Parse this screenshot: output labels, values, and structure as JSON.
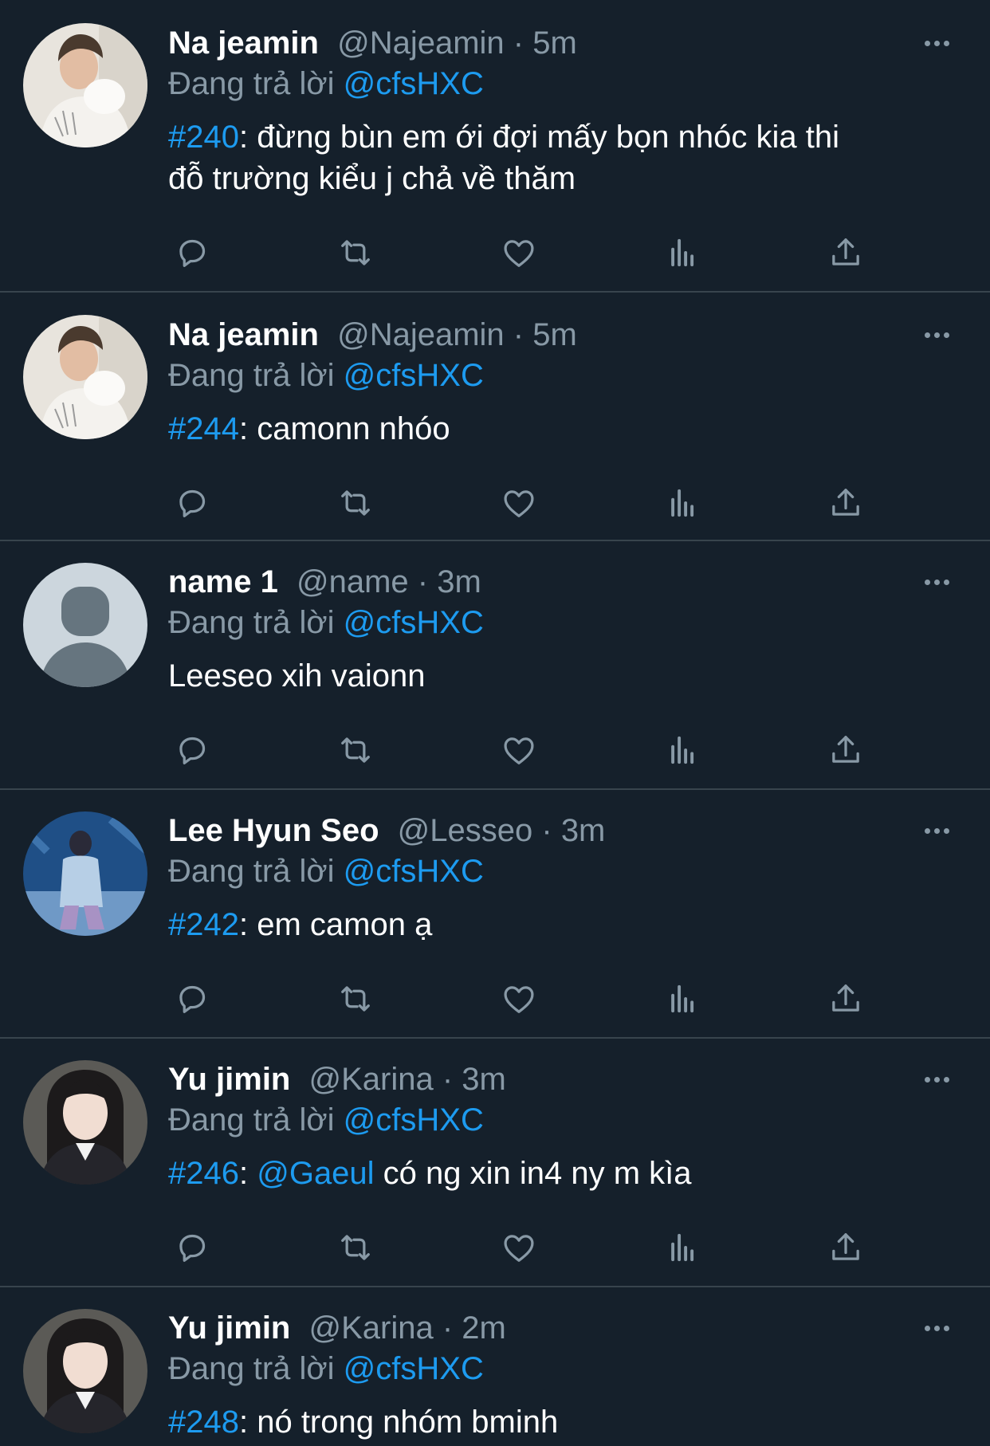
{
  "replying_label": "Đang trả lời",
  "tweets": [
    {
      "name": "Na jeamin",
      "handle": "@Najeamin",
      "sep": "·",
      "time": "5m",
      "reply_to": "@cfsHXC",
      "tag": "#240",
      "text_lines": [
        ": đừng bùn em ới đợi mấy bọn nhóc kia thi",
        "đỗ trường kiểu j chả về thăm"
      ]
    },
    {
      "name": "Na jeamin",
      "handle": "@Najeamin",
      "sep": "·",
      "time": "5m",
      "reply_to": "@cfsHXC",
      "tag": "#244",
      "text": ": camonn nhóo"
    },
    {
      "name": "name 1",
      "handle": "@name",
      "sep": "·",
      "time": "3m",
      "reply_to": "@cfsHXC",
      "text": "Leeseo xih vaionn"
    },
    {
      "name": "Lee Hyun Seo",
      "handle": "@Lesseo",
      "sep": "·",
      "time": "3m",
      "reply_to": "@cfsHXC",
      "tag": "#242",
      "text": ": em camon ạ"
    },
    {
      "name": "Yu jimin",
      "handle": "@Karina",
      "sep": "·",
      "time": "3m",
      "reply_to": "@cfsHXC",
      "tag": "#246",
      "colon": ": ",
      "mention": "@Gaeul",
      "text": " có ng xin in4 ny m kìa"
    },
    {
      "name": "Yu jimin",
      "handle": "@Karina",
      "sep": "·",
      "time": "2m",
      "reply_to": "@cfsHXC",
      "tag": "#248",
      "text": ": nó trong nhóm bminh"
    }
  ],
  "icons": {
    "reply": "speech-bubble-icon",
    "retweet": "retweet-icon",
    "like": "heart-icon",
    "views": "bar-chart-icon",
    "share": "share-upload-icon",
    "more": "ellipsis-icon"
  },
  "colors": {
    "background": "#15202b",
    "accent": "#1d9bf0",
    "secondary_text": "#8899a6",
    "divider": "#38444d"
  }
}
